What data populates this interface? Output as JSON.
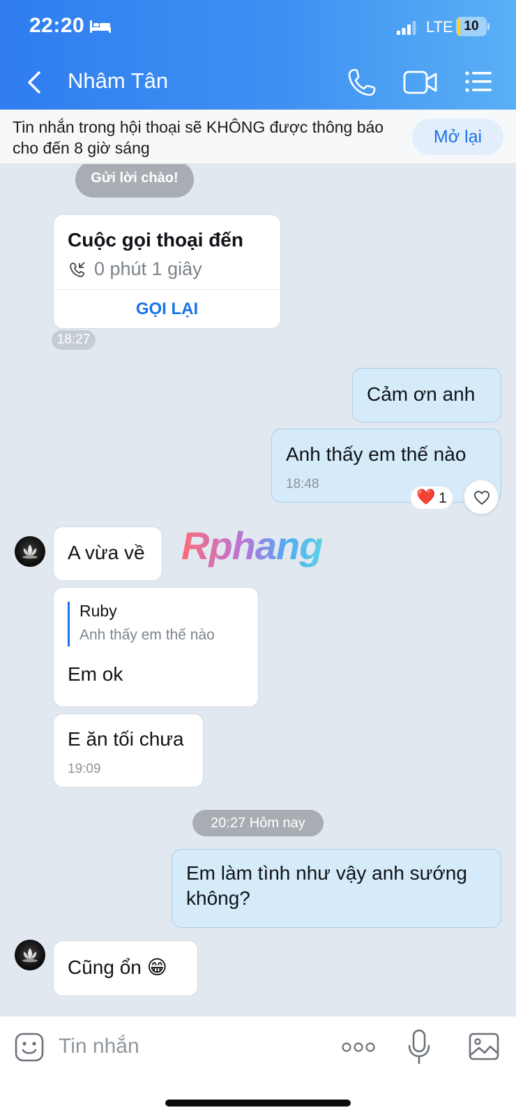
{
  "status_bar": {
    "time": "22:20",
    "network": "LTE",
    "battery_percent": 10,
    "battery_label": "10"
  },
  "header": {
    "contact_name": "Nhâm Tân"
  },
  "notice": {
    "text": "Tin nhắn trong hội thoại sẽ KHÔNG được thông báo cho đến 8 giờ sáng",
    "reopen_label": "Mở lại"
  },
  "chat": {
    "greeting_label": "Gửi lời chào!",
    "call_card": {
      "title": "Cuộc gọi thoại đến",
      "duration": "0 phút 1 giây",
      "callback_label": "GỌI LẠI",
      "time": "18:27"
    },
    "msg_thanks": "Cảm ơn anh",
    "msg_question": {
      "text": "Anh thấy em thế nào",
      "time": "18:48",
      "reaction_emoji": "❤️",
      "reaction_count": "1"
    },
    "msg_arrived": "A vừa về",
    "watermark": "Rphang",
    "reply_msg": {
      "quote_name": "Ruby",
      "quote_text": "Anh thấy em thế nào",
      "text": "Em ok"
    },
    "msg_dinner": {
      "text": "E ăn tối chưa",
      "time": "19:09"
    },
    "day_separator": "20:27 Hôm nay",
    "msg_me_long_line1": "Em làm tình như vậy anh sướng",
    "msg_me_long_line2": "không?",
    "msg_last": "Cũng ổn 😁"
  },
  "composer": {
    "placeholder": "Tin nhắn"
  },
  "colors": {
    "header_start": "#2f7df0",
    "header_end": "#5ab0f5",
    "chat_bg": "#e2e8f0",
    "my_bubble": "#d5ebfa",
    "accent": "#1a73e8"
  }
}
